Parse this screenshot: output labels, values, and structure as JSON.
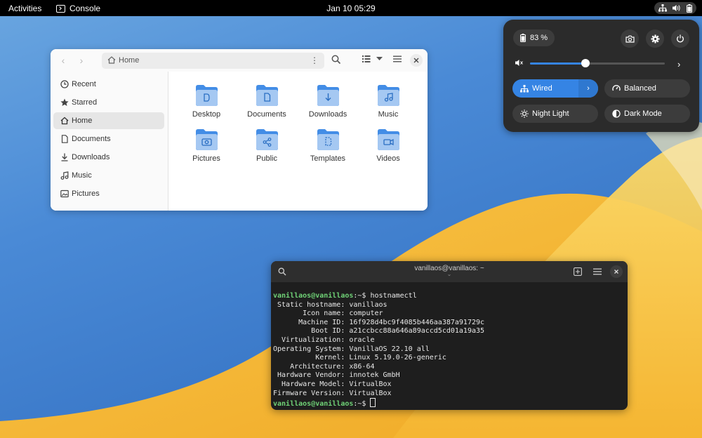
{
  "topbar": {
    "activities": "Activities",
    "app_name": "Console",
    "clock": "Jan 10  05:29"
  },
  "files": {
    "path_label": "Home",
    "sidebar": [
      {
        "label": "Recent",
        "icon": "clock-icon"
      },
      {
        "label": "Starred",
        "icon": "star-icon"
      },
      {
        "label": "Home",
        "icon": "home-icon",
        "active": true
      },
      {
        "label": "Documents",
        "icon": "document-icon"
      },
      {
        "label": "Downloads",
        "icon": "download-icon"
      },
      {
        "label": "Music",
        "icon": "music-icon"
      },
      {
        "label": "Pictures",
        "icon": "picture-icon"
      }
    ],
    "folders": [
      {
        "label": "Desktop",
        "glyph": "desktop"
      },
      {
        "label": "Documents",
        "glyph": "document"
      },
      {
        "label": "Downloads",
        "glyph": "download"
      },
      {
        "label": "Music",
        "glyph": "music"
      },
      {
        "label": "Pictures",
        "glyph": "camera"
      },
      {
        "label": "Public",
        "glyph": "share"
      },
      {
        "label": "Templates",
        "glyph": "template"
      },
      {
        "label": "Videos",
        "glyph": "video"
      }
    ]
  },
  "quick_settings": {
    "battery": "83 %",
    "volume_fraction": 0.41,
    "toggles": {
      "wired": "Wired",
      "balanced": "Balanced",
      "night_light": "Night Light",
      "dark_mode": "Dark Mode"
    },
    "accent": "#3584e4"
  },
  "terminal": {
    "title": "vanillaos@vanillaos: ~",
    "prompt_user": "vanillaos@vanillaos",
    "prompt_path": ":~$ ",
    "command": "hostnamectl",
    "output": [
      " Static hostname: vanillaos",
      "       Icon name: computer",
      "      Machine ID: 16f928d4bc9f4085b446aa387a91729c",
      "         Boot ID: a21ccbcc88a646a89accd5cd01a19a35",
      "  Virtualization: oracle",
      "Operating System: VanillaOS 22.10 all",
      "          Kernel: Linux 5.19.0-26-generic",
      "    Architecture: x86-64",
      " Hardware Vendor: innotek GmbH",
      "  Hardware Model: VirtualBox",
      "Firmware Version: VirtualBox"
    ],
    "prompt_end": ":~$ "
  }
}
